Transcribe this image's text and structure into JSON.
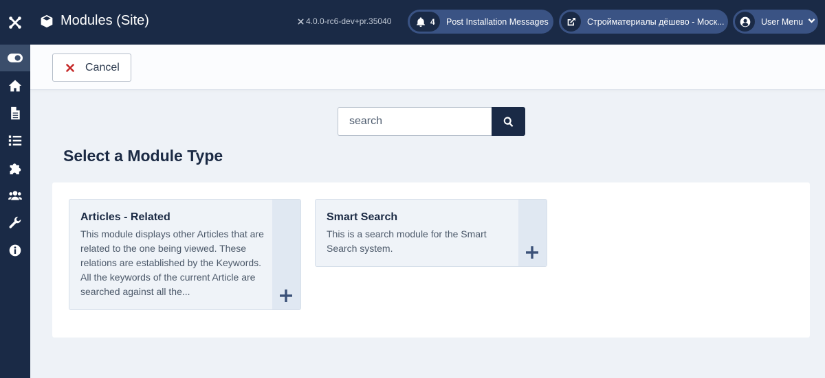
{
  "header": {
    "title": "Modules (Site)",
    "version": "4.0.0-rc6-dev+pr.35040",
    "notifications": {
      "count": "4",
      "label": "Post Installation Messages"
    },
    "site_link": "Стройматериалы дёшево - Моск...",
    "user_menu": "User Menu"
  },
  "toolbar": {
    "cancel_label": "Cancel"
  },
  "search": {
    "placeholder": "search"
  },
  "main": {
    "section_title": "Select a Module Type",
    "modules": [
      {
        "title": "Articles - Related",
        "description": "This module displays other Articles that are related to the one being viewed. These relations are established by the Keywords. All the keywords of the current Article are searched against all the..."
      },
      {
        "title": "Smart Search",
        "description": "This is a search module for the Smart Search system."
      }
    ]
  },
  "sidebar": {
    "icons": [
      "toggle-icon",
      "home-icon",
      "file-icon",
      "list-icon",
      "puzzle-icon",
      "users-icon",
      "wrench-icon",
      "info-icon"
    ]
  },
  "colors": {
    "header_bg": "#1a2a46",
    "pill_bg": "#3a5384",
    "cancel_icon": "#c52827"
  }
}
